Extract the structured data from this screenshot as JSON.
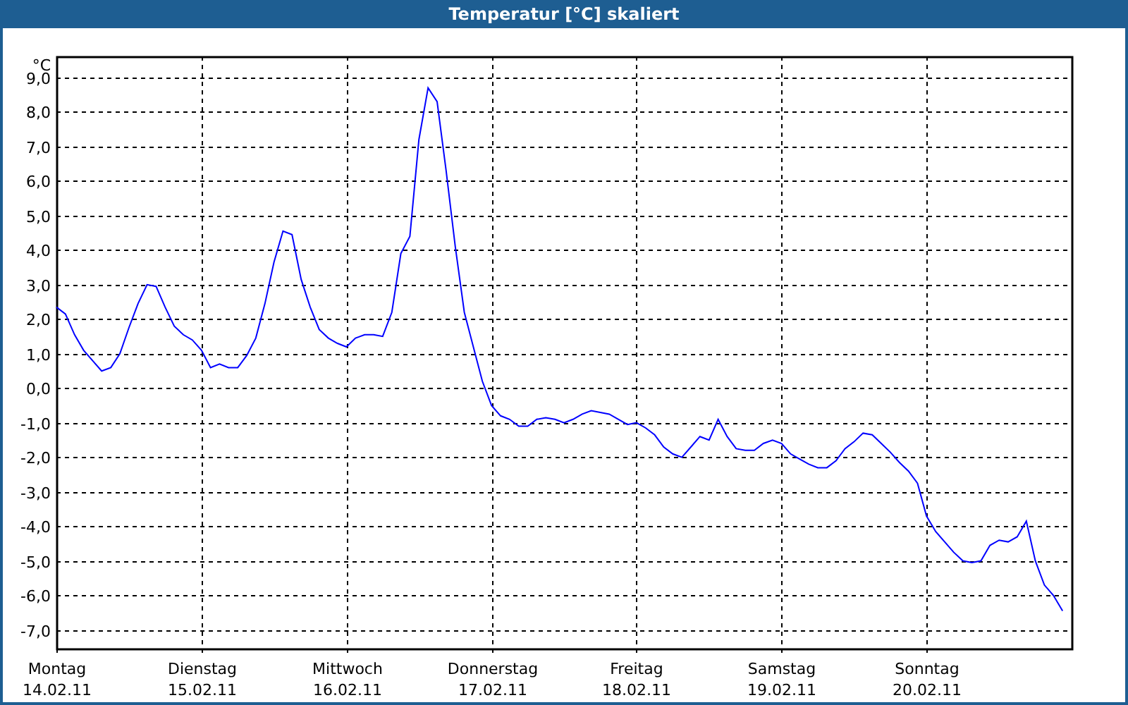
{
  "window": {
    "title": "Temperatur [°C] skaliert"
  },
  "chart": {
    "chart_data": {
      "type": "line",
      "grid": true,
      "ylabel": "°C",
      "ylim": [
        -7.54,
        9.61
      ],
      "yticks": [
        {
          "value": 9,
          "label": "9,0"
        },
        {
          "value": 8,
          "label": "8,0"
        },
        {
          "value": 7,
          "label": "7,0"
        },
        {
          "value": 6,
          "label": "6,0"
        },
        {
          "value": 5,
          "label": "5,0"
        },
        {
          "value": 4,
          "label": "4,0"
        },
        {
          "value": 3,
          "label": "3,0"
        },
        {
          "value": 2,
          "label": "2,0"
        },
        {
          "value": 1,
          "label": "1,0"
        },
        {
          "value": 0,
          "label": "0,0"
        },
        {
          "value": -1,
          "label": "-1,0"
        },
        {
          "value": -2,
          "label": "-2,0"
        },
        {
          "value": -3,
          "label": "-3,0"
        },
        {
          "value": -4,
          "label": "-4,0"
        },
        {
          "value": -5,
          "label": "-5,0"
        },
        {
          "value": -6,
          "label": "-6,0"
        },
        {
          "value": -7,
          "label": "-7,0"
        }
      ],
      "categories": [
        "Montag",
        null,
        null,
        null,
        null,
        null,
        null,
        null,
        null,
        null,
        null,
        null,
        null,
        null,
        null,
        null,
        "Dienstag",
        null,
        null,
        null,
        null,
        null,
        null,
        null,
        null,
        null,
        null,
        null,
        null,
        null,
        null,
        null,
        "Mittwoch",
        null,
        null,
        null,
        null,
        null,
        null,
        null,
        null,
        null,
        null,
        null,
        null,
        null,
        null,
        null,
        "Donnerstag",
        null,
        null,
        null,
        null,
        null,
        null,
        null,
        null,
        null,
        null,
        null,
        null,
        null,
        null,
        null,
        "Freitag",
        null,
        null,
        null,
        null,
        null,
        null,
        null,
        null,
        null,
        null,
        null,
        null,
        null,
        null,
        null,
        "Samstag",
        null,
        null,
        null,
        null,
        null,
        null,
        null,
        null,
        null,
        null,
        null,
        null,
        null,
        null,
        null,
        "Sonntag",
        null,
        null,
        null,
        null,
        null,
        null,
        null,
        null,
        null,
        null,
        null,
        null,
        null,
        null,
        null,
        null
      ],
      "series": [
        {
          "color": "#0000ff",
          "values": [
            2.35,
            2.15,
            1.55,
            1.1,
            0.8,
            0.5,
            0.6,
            1.0,
            1.75,
            2.45,
            3.0,
            2.95,
            2.35,
            1.8,
            1.55,
            1.4,
            1.1,
            0.6,
            0.7,
            0.6,
            0.6,
            0.95,
            1.45,
            2.45,
            3.65,
            4.55,
            4.45,
            3.15,
            2.35,
            1.7,
            1.45,
            1.3,
            1.2,
            1.45,
            1.55,
            1.55,
            1.5,
            2.2,
            3.9,
            4.4,
            7.2,
            8.7,
            8.3,
            6.3,
            4.1,
            2.2,
            1.2,
            0.2,
            -0.5,
            -0.8,
            -0.9,
            -1.1,
            -1.1,
            -0.9,
            -0.85,
            -0.9,
            -1.0,
            -0.9,
            -0.75,
            -0.65,
            -0.7,
            -0.75,
            -0.9,
            -1.05,
            -1.0,
            -1.15,
            -1.35,
            -1.7,
            -1.9,
            -2.0,
            -1.7,
            -1.4,
            -1.5,
            -0.9,
            -1.4,
            -1.75,
            -1.8,
            -1.8,
            -1.6,
            -1.5,
            -1.6,
            -1.9,
            -2.05,
            -2.2,
            -2.3,
            -2.3,
            -2.1,
            -1.75,
            -1.55,
            -1.3,
            -1.35,
            -1.6,
            -1.85,
            -2.15,
            -2.4,
            -2.75,
            -3.7,
            -4.15,
            -4.45,
            -4.75,
            -5.0,
            -5.05,
            -5.0,
            -4.55,
            -4.4,
            -4.45,
            -4.3,
            -3.85,
            -5.0,
            -5.7,
            -6.0,
            -6.45,
            null
          ]
        }
      ]
    },
    "day_dates": [
      "14.02.11",
      "15.02.11",
      "16.02.11",
      "17.02.11",
      "18.02.11",
      "19.02.11",
      "20.02.11"
    ]
  }
}
